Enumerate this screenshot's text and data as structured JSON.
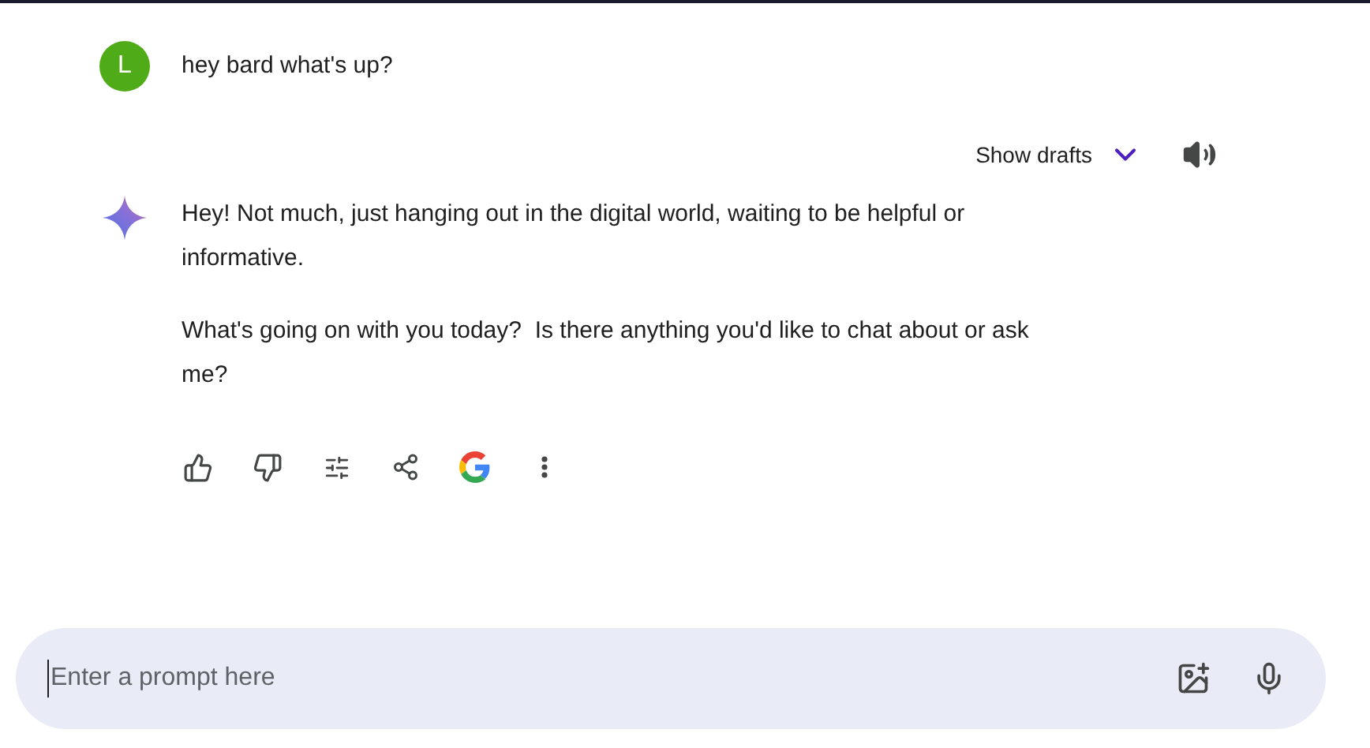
{
  "user_message": {
    "avatar_letter": "L",
    "text": "hey bard what's up?"
  },
  "response_header": {
    "show_drafts": "Show drafts"
  },
  "response": {
    "paragraphs": [
      "Hey! Not much, just hanging out in the digital world, waiting to be helpful or informative.",
      "What's going on with you today?  Is there anything you'd like to chat about or ask me?"
    ]
  },
  "prompt": {
    "placeholder": "Enter a prompt here"
  }
}
